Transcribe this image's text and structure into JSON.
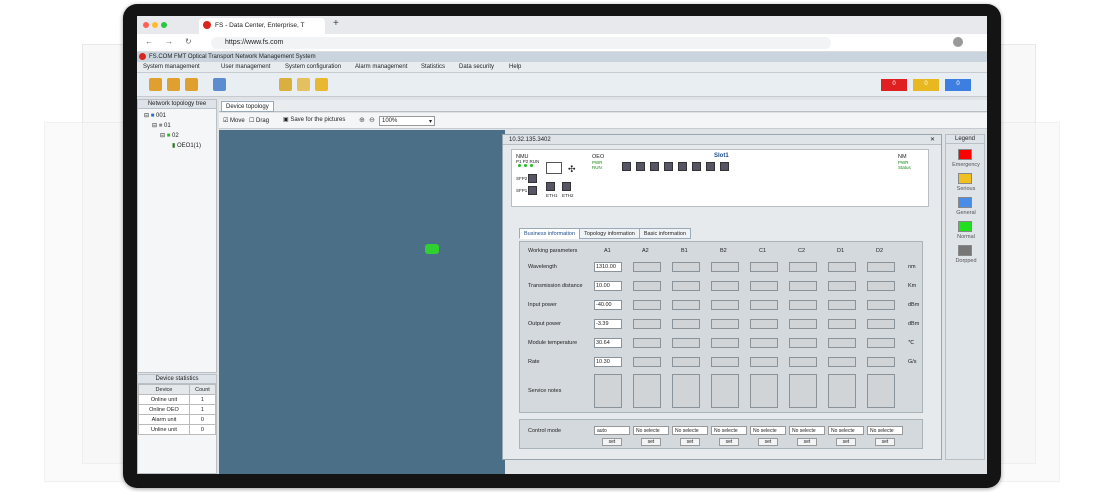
{
  "browser": {
    "tab_title": "FS - Data Center, Enterprise, T",
    "url": "https://www.fs.com"
  },
  "app": {
    "title": "FS.COM FMT Optical Transport Network Management System",
    "menu": [
      "System management",
      "User management",
      "System configuration",
      "Alarm management",
      "Statistics",
      "Data security",
      "Help"
    ],
    "alarms": [
      {
        "value": "0",
        "color": "#e02020"
      },
      {
        "value": "0",
        "color": "#e8b820"
      },
      {
        "value": "0",
        "color": "#3d7fe0"
      }
    ],
    "tree": {
      "title": "Network topology tree",
      "nodes": [
        "001",
        "01",
        "02",
        "OEO1(1)"
      ]
    },
    "stats": {
      "title": "Device statistics",
      "headers": [
        "Device",
        "Count"
      ],
      "rows": [
        [
          "Online unit",
          "1"
        ],
        [
          "Online OEO",
          "1"
        ],
        [
          "Alarm unit",
          "0"
        ],
        [
          "Unline unit",
          "0"
        ]
      ]
    },
    "topology": {
      "tab": "Device topology",
      "move": "Move",
      "drag": "Drag",
      "save": "Save for the pictures",
      "zoom": "100%"
    },
    "dialog": {
      "title": "10.32.135.3402",
      "panel": {
        "nmu": "NMU",
        "oeo": "OEO",
        "nm": "NM",
        "slot": "Slot1",
        "pwr": "PWR",
        "run": "RUN",
        "status": "Status",
        "eth1": "ETH1",
        "eth2": "ETH2",
        "sfp1": "SFP1",
        "sfp2": "SFP2",
        "p1p2": "P1 P2 RUN"
      },
      "tabs": [
        "Business information",
        "Topology information",
        "Basic information"
      ],
      "columns": [
        "Working parameters",
        "A1",
        "A2",
        "B1",
        "B2",
        "C1",
        "C2",
        "D1",
        "D2"
      ],
      "rows": [
        {
          "label": "Wavelength",
          "a1": "1310.00",
          "unit": "nm"
        },
        {
          "label": "Transmission distance",
          "a1": "10.00",
          "unit": "Km"
        },
        {
          "label": "Input power",
          "a1": "-40.00",
          "unit": "dBm"
        },
        {
          "label": "Output power",
          "a1": "-3.39",
          "unit": "dBm"
        },
        {
          "label": "Module temperature",
          "a1": "30.64",
          "unit": "℃"
        },
        {
          "label": "Rate",
          "a1": "10.30",
          "unit": "G/s"
        }
      ],
      "service_notes": "Service notes",
      "control": {
        "label": "Control mode",
        "first": "auto",
        "other": "No selecte",
        "set": "set"
      }
    },
    "legend": {
      "title": "Legend",
      "items": [
        {
          "label": "Emergency",
          "color": "#ff0000"
        },
        {
          "label": "Serious",
          "color": "#f0c020"
        },
        {
          "label": "General",
          "color": "#4a8de8"
        },
        {
          "label": "Normal",
          "color": "#20e020"
        },
        {
          "label": "Dorpped",
          "color": "#777777"
        }
      ]
    }
  }
}
